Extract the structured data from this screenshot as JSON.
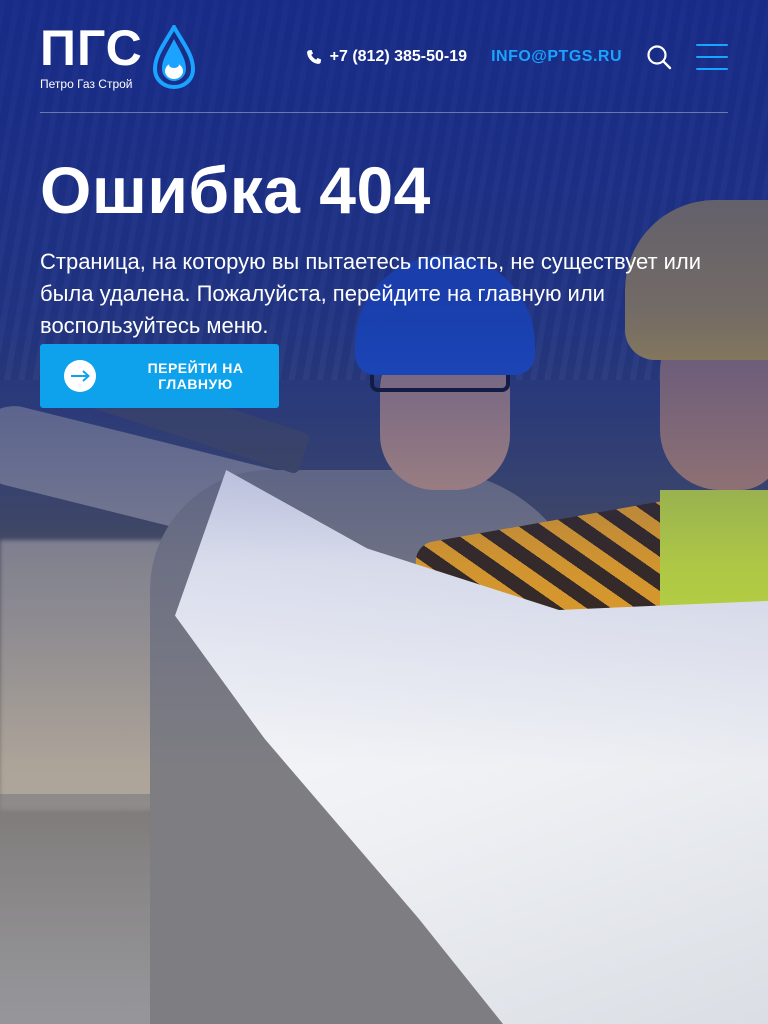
{
  "header": {
    "logo_mark": "ПГС",
    "logo_subtitle": "Петро Газ Строй",
    "phone": "+7 (812) 385-50-19",
    "email": "INFO@PTGS.RU",
    "search_icon": "search-icon",
    "menu_icon": "hamburger-menu-icon"
  },
  "main": {
    "title": "Ошибка 404",
    "lead": "Страница, на которую вы пытаетесь попасть, не существует или была удалена. Пожалуйста, перейдите на главную или воспользуйтесь меню.",
    "cta_label": "ПЕРЕЙТИ НА ГЛАВНУЮ",
    "cta_icon": "arrow-right-icon"
  },
  "colors": {
    "accent": "#0ea2ec",
    "email_link": "#1aa3ff",
    "overlay": "#162a8c"
  }
}
